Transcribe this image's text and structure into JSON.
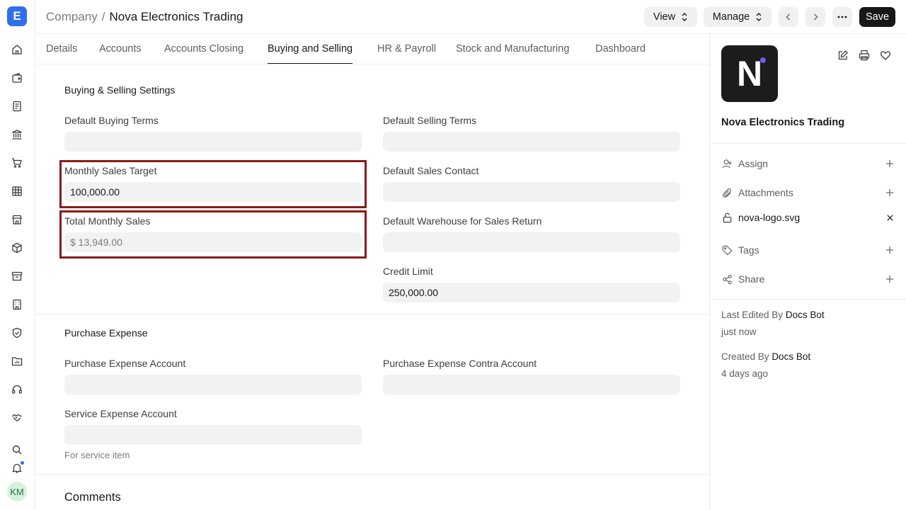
{
  "app": {
    "logo_letter": "E"
  },
  "breadcrumb": {
    "parent": "Company",
    "separator": "/",
    "current": "Nova Electronics Trading"
  },
  "header": {
    "view_label": "View",
    "manage_label": "Manage",
    "save_label": "Save"
  },
  "tabs": [
    {
      "label": "Details"
    },
    {
      "label": "Accounts"
    },
    {
      "label": "Accounts Closing"
    },
    {
      "label": "Buying and Selling",
      "active": true
    },
    {
      "label": "HR & Payroll"
    },
    {
      "label": "Stock and Manufacturing"
    },
    {
      "label": "Dashboard"
    }
  ],
  "buying_selling": {
    "title": "Buying & Selling Settings",
    "default_buying_terms": {
      "label": "Default Buying Terms",
      "value": ""
    },
    "default_selling_terms": {
      "label": "Default Selling Terms",
      "value": ""
    },
    "monthly_sales_target": {
      "label": "Monthly Sales Target",
      "value": "100,000.00"
    },
    "default_sales_contact": {
      "label": "Default Sales Contact",
      "value": ""
    },
    "total_monthly_sales": {
      "label": "Total Monthly Sales",
      "value": "$ 13,949.00"
    },
    "default_warehouse_return": {
      "label": "Default Warehouse for Sales Return",
      "value": ""
    },
    "credit_limit": {
      "label": "Credit Limit",
      "value": "250,000.00"
    }
  },
  "purchase_expense": {
    "title": "Purchase Expense",
    "purchase_expense_account": {
      "label": "Purchase Expense Account",
      "value": ""
    },
    "purchase_expense_contra_account": {
      "label": "Purchase Expense Contra Account",
      "value": ""
    },
    "service_expense_account": {
      "label": "Service Expense Account",
      "value": "",
      "hint": "For service item"
    }
  },
  "comments": {
    "title": "Comments"
  },
  "sidebar": {
    "org_logo_letter": "N",
    "org_name": "Nova Electronics Trading",
    "assign_label": "Assign",
    "attachments_label": "Attachments",
    "attachment_file": "nova-logo.svg",
    "tags_label": "Tags",
    "share_label": "Share",
    "last_edited_prefix": "Last Edited By",
    "last_edited_by": "Docs Bot",
    "last_edited_time": "just now",
    "created_prefix": "Created By",
    "created_by": "Docs Bot",
    "created_time": "4 days ago"
  },
  "user": {
    "initials": "KM"
  },
  "colors": {
    "accent": "#2f6fed",
    "highlight_border": "#8b1a1a",
    "dark_button": "#171717"
  }
}
